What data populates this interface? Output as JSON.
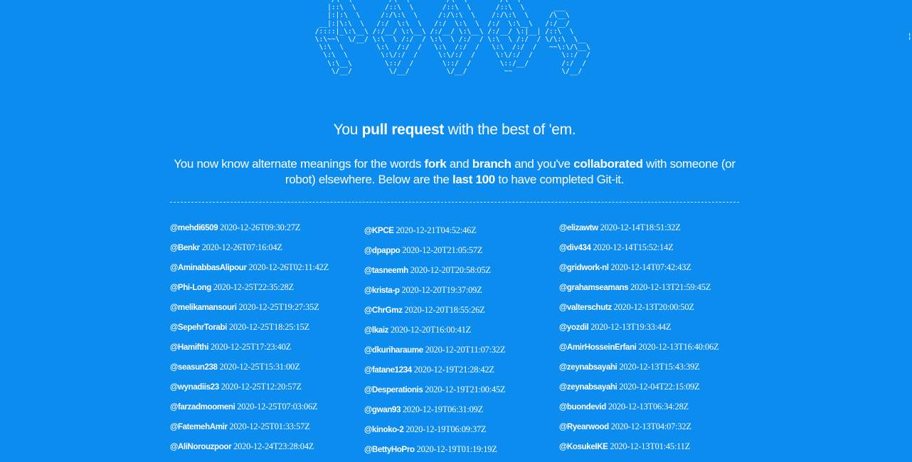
{
  "ascii_banner": "     /\\  \\         /\\  \\         /\\  \\        /\\  \\\n    |::\\  \\       /::\\  \\       /::\\  \\      /::\\  \\       ___\n    |:|:\\  \\     /:/\\:\\  \\     /:/\\:\\  \\    /:/\\:\\  \\     /\\__\\\n  __|:|\\:\\  \\   /:/  \\:\\  \\   /:/  \\:\\  \\  /:/  \\:\\__\\   /:/__/\n /::::|_\\:\\__\\ /:/__/ \\:\\__\\ /:/__/ \\:\\__\\ /:/__/ \\:|__| /::\\  \\\n \\:\\~~\\  \\/__/ \\:\\  \\ /:/  / \\:\\  \\ /:/  / \\:\\  \\ /:/  / \\/\\:\\  \\__\n  \\:\\  \\        \\:\\  /:/  /   \\:\\  /:/  /   \\:\\  /:/  /   ~~\\:\\/\\__\\\n   \\:\\  \\        \\:\\/:/  /     \\:\\/:/  /     \\:\\/:/  /       \\::/  /\n    \\:\\__\\        \\::/  /       \\::/  /       \\::/__/        /:/  /\n     \\/__/         \\/__/         \\/__/         ~~            \\/__/",
  "edge_glyph": "¦",
  "headline": {
    "prefix": "You ",
    "strong": "pull request",
    "suffix": " with the best of 'em."
  },
  "intro": {
    "p1": "You now know alternate meanings for the words ",
    "b1": "fork",
    "p2": " and ",
    "b2": "branch",
    "p3": " and you've ",
    "b3": "collaborated",
    "p4": " with someone (or robot) elsewhere. Below are the ",
    "b4": "last 100",
    "p5": " to have completed Git-it."
  },
  "completions": {
    "columns": [
      [
        {
          "user": "@mehdi6509",
          "time": "2020-12-26T09:30:27Z"
        },
        {
          "user": "@Benkr",
          "time": "2020-12-26T07:16:04Z"
        },
        {
          "user": "@AminabbasAlipour",
          "time": "2020-12-26T02:11:42Z"
        },
        {
          "user": "@Phi-Long",
          "time": "2020-12-25T22:35:28Z"
        },
        {
          "user": "@melikamansouri",
          "time": "2020-12-25T19:27:35Z"
        },
        {
          "user": "@SepehrTorabi",
          "time": "2020-12-25T18:25:15Z"
        },
        {
          "user": "@Hamifthi",
          "time": "2020-12-25T17:23:40Z"
        },
        {
          "user": "@seasun238",
          "time": "2020-12-25T15:31:00Z"
        },
        {
          "user": "@wynadiis23",
          "time": "2020-12-25T12:20:57Z"
        },
        {
          "user": "@farzadmoomeni",
          "time": "2020-12-25T07:03:06Z"
        },
        {
          "user": "@FatemehAmir",
          "time": "2020-12-25T01:33:57Z"
        },
        {
          "user": "@AliNorouzpoor",
          "time": "2020-12-24T23:28:04Z"
        }
      ],
      [
        {
          "user": "@KPCE",
          "time": "2020-12-21T04:52:46Z"
        },
        {
          "user": "@dpappo",
          "time": "2020-12-20T21:05:57Z"
        },
        {
          "user": "@tasneemh",
          "time": "2020-12-20T20:58:05Z"
        },
        {
          "user": "@krista-p",
          "time": "2020-12-20T19:37:09Z"
        },
        {
          "user": "@ChrGmz",
          "time": "2020-12-20T18:55:26Z"
        },
        {
          "user": "@lkaiz",
          "time": "2020-12-20T16:00:41Z"
        },
        {
          "user": "@dkuriharaume",
          "time": "2020-12-20T11:07:32Z"
        },
        {
          "user": "@fatane1234",
          "time": "2020-12-19T21:28:42Z"
        },
        {
          "user": "@Desperationis",
          "time": "2020-12-19T21:00:45Z"
        },
        {
          "user": "@gwan93",
          "time": "2020-12-19T06:31:09Z"
        },
        {
          "user": "@kinoko-2",
          "time": "2020-12-19T06:09:37Z"
        },
        {
          "user": "@BettyHoPro",
          "time": "2020-12-19T01:19:19Z"
        }
      ],
      [
        {
          "user": "@elizawtw",
          "time": "2020-12-14T18:51:32Z"
        },
        {
          "user": "@div434",
          "time": "2020-12-14T15:52:14Z"
        },
        {
          "user": "@gridwork-nl",
          "time": "2020-12-14T07:42:43Z"
        },
        {
          "user": "@grahamseamans",
          "time": "2020-12-13T21:59:45Z"
        },
        {
          "user": "@valterschutz",
          "time": "2020-12-13T20:00:50Z"
        },
        {
          "user": "@yozdil",
          "time": "2020-12-13T19:33:44Z"
        },
        {
          "user": "@AmirHosseinErfani",
          "time": "2020-12-13T16:40:06Z"
        },
        {
          "user": "@zeynabsayahi",
          "time": "2020-12-13T15:43:39Z"
        },
        {
          "user": "@zeynabsayahi",
          "time": "2020-12-04T22:15:09Z"
        },
        {
          "user": "@buondevid",
          "time": "2020-12-13T06:34:28Z"
        },
        {
          "user": "@Ryearwood",
          "time": "2020-12-13T04:07:32Z"
        },
        {
          "user": "@KosukeIKE",
          "time": "2020-12-13T01:45:11Z"
        }
      ]
    ]
  },
  "colors": {
    "background": "#0d8cf0",
    "text": "#ffffff",
    "divider": "#cfe7fc"
  }
}
